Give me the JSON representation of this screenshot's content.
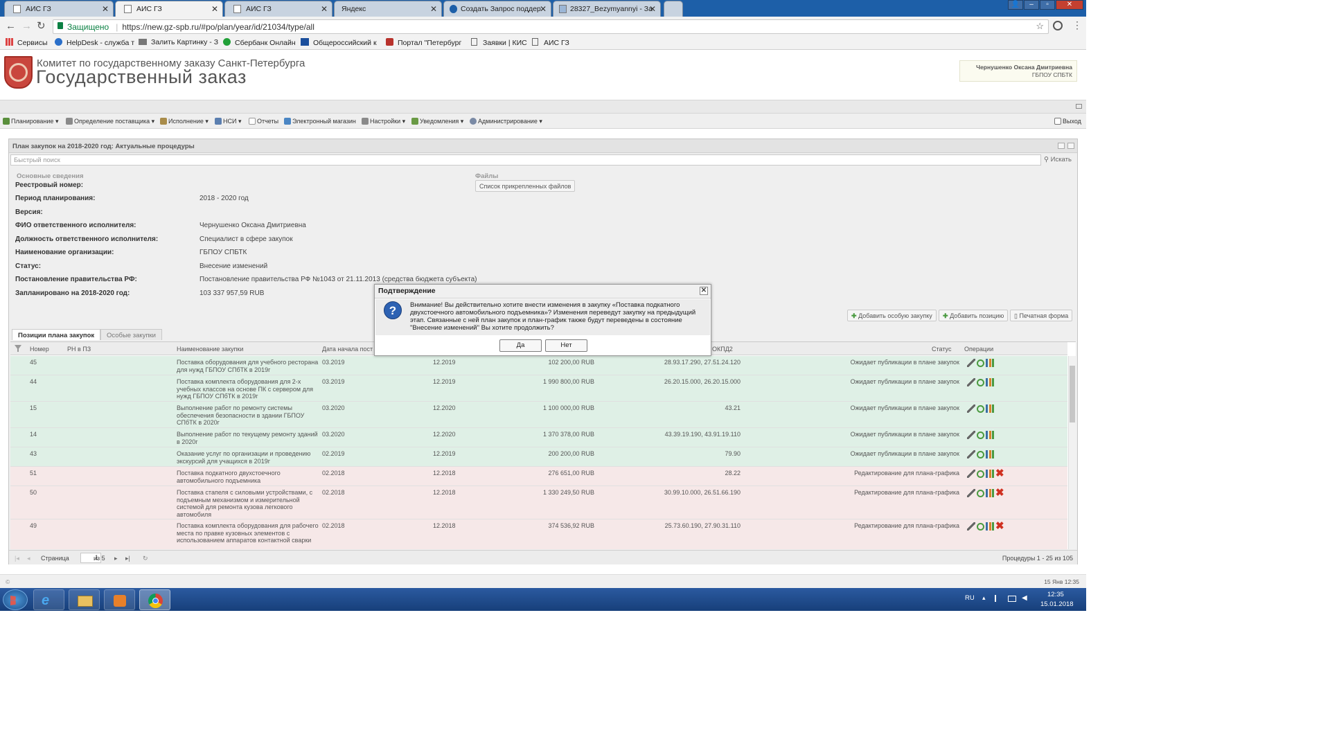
{
  "browser": {
    "tabs": [
      {
        "title": "АИС ГЗ"
      },
      {
        "title": "АИС ГЗ"
      },
      {
        "title": "АИС ГЗ"
      },
      {
        "title": "Яндекс"
      },
      {
        "title": "Создать Запрос поддер"
      },
      {
        "title": "28327_Bezymyannyi - За"
      }
    ],
    "security_label": "Защищено",
    "url": "https://new.gz-spb.ru/#po/plan/year/id/21034/type/all",
    "bookmarks": [
      {
        "label": "Сервисы"
      },
      {
        "label": "HelpDesk - служба т"
      },
      {
        "label": "Залить Картинку - З"
      },
      {
        "label": "Сбербанк Онлайн"
      },
      {
        "label": "Общероссийский к"
      },
      {
        "label": "Портал \"Петербург"
      },
      {
        "label": "Заявки | КИС"
      },
      {
        "label": "АИС ГЗ"
      }
    ]
  },
  "header": {
    "org_line": "Комитет по государственному заказу Санкт-Петербурга",
    "app_title": "Государственный заказ",
    "user_name": "Чернушенко Оксана Дмитриевна",
    "user_org": "ГБПОУ СПБТК"
  },
  "menu": {
    "items": [
      {
        "label": "Планирование"
      },
      {
        "label": "Определение поставщика"
      },
      {
        "label": "Исполнение"
      },
      {
        "label": "НСИ"
      },
      {
        "label": "Отчеты"
      },
      {
        "label": "Электронный магазин"
      },
      {
        "label": "Настройки"
      },
      {
        "label": "Уведомления"
      },
      {
        "label": "Администрирование"
      }
    ],
    "logout": "Выход"
  },
  "panel": {
    "title": "План закупок на 2018-2020 год: Актуальные процедуры",
    "search_placeholder": "Быстрый поиск",
    "search_button": "Искать",
    "section_main": "Основные сведения",
    "section_files": "Файлы",
    "files_button": "Список прикрепленных файлов",
    "fields": [
      {
        "label": "Реестровый номер:",
        "value": ""
      },
      {
        "label": "Период планирования:",
        "value": "2018 - 2020 год"
      },
      {
        "label": "Версия:",
        "value": ""
      },
      {
        "label": "ФИО ответственного исполнителя:",
        "value": "Чернушенко Оксана Дмитриевна"
      },
      {
        "label": "Должность ответственного исполнителя:",
        "value": "Специалист в сфере закупок"
      },
      {
        "label": "Наименование организации:",
        "value": "ГБПОУ СПБТК"
      },
      {
        "label": "Статус:",
        "value": "Внесение изменений"
      },
      {
        "label": "Постановление правительства РФ:",
        "value": "Постановление правительства РФ №1043 от 21.11.2013 (средства бюджета субъекта)"
      },
      {
        "label": "Запланировано на 2018-2020 год:",
        "value": "103 337 957,59 RUB"
      }
    ],
    "actions": {
      "add_special": "Добавить особую закупку",
      "add_position": "Добавить позицию",
      "print_form": "Печатная форма"
    },
    "tabs": [
      {
        "label": "Позиции плана закупок"
      },
      {
        "label": "Особые закупки"
      }
    ]
  },
  "grid": {
    "columns": {
      "number": "Номер",
      "rn": "РН в ПЗ",
      "name": "Наименование закупки",
      "start": "Дата начала пост",
      "okpd": "ОКПД2",
      "status": "Статус",
      "ops": "Операции"
    },
    "rows": [
      {
        "number": "45",
        "name": "Поставка оборудования для учебного ресторана для нужд ГБПОУ СПбТК в 2019г",
        "start": "03.2019",
        "end": "12.2019",
        "sum": "102 200,00 RUB",
        "okpd": "28.93.17.290, 27.51.24.120",
        "status": "Ожидает публикации в плане закупок"
      },
      {
        "number": "44",
        "name": "Поставка комплекта оборудования для 2-х учебных классов на основе ПК с сервером для нужд ГБПОУ СПбТК в 2019г",
        "start": "03.2019",
        "end": "12.2019",
        "sum": "1 990 800,00 RUB",
        "okpd": "26.20.15.000, 26.20.15.000",
        "status": "Ожидает публикации в плане закупок"
      },
      {
        "number": "15",
        "name": "Выполнение работ по ремонту системы обеспечения безопасности в здании ГБПОУ СПбТК в 2020г",
        "start": "03.2020",
        "end": "12.2020",
        "sum": "1 100 000,00 RUB",
        "okpd": "43.21",
        "status": "Ожидает публикации в плане закупок"
      },
      {
        "number": "14",
        "name": "Выполнение работ по текущему ремонту зданий в 2020г",
        "start": "03.2020",
        "end": "12.2020",
        "sum": "1 370 378,00 RUB",
        "okpd": "43.39.19.190, 43.91.19.110",
        "status": "Ожидает публикации в плане закупок"
      },
      {
        "number": "43",
        "name": "Оказание услуг по организации и проведению экскурсий для учащихся в 2019г",
        "start": "02.2019",
        "end": "12.2019",
        "sum": "200 200,00 RUB",
        "okpd": "79.90",
        "status": "Ожидает публикации в плане закупок"
      },
      {
        "number": "51",
        "name": "Поставка подкатного двухстоечного автомобильного подъемника",
        "start": "02.2018",
        "end": "12.2018",
        "sum": "276 651,00 RUB",
        "okpd": "28.22",
        "status": "Редактирование для плана-графика"
      },
      {
        "number": "50",
        "name": "Поставка стапеля с силовыми устройствами, с подъемным механизмом и измерительной системой для ремонта кузова легкового автомобиля",
        "start": "02.2018",
        "end": "12.2018",
        "sum": "1 330 249,50 RUB",
        "okpd": "30.99.10.000, 26.51.66.190",
        "status": "Редактирование для плана-графика"
      },
      {
        "number": "49",
        "name": "Поставка комплекта оборудования для рабочего места по правке кузовных элементов с использованием аппаратов контактной сварки",
        "start": "02.2018",
        "end": "12.2018",
        "sum": "374 536,92 RUB",
        "okpd": "25.73.60.190, 27.90.31.110",
        "status": "Редактирование для плана-графика"
      }
    ]
  },
  "pager": {
    "page_label": "Страница",
    "page_value": "1",
    "of_label": "из 5",
    "summary": "Процедуры 1 - 25 из 105"
  },
  "dialog": {
    "title": "Подтверждение",
    "message": "Внимание! Вы действительно хотите внести изменения в закупку «Поставка подкатного двухстоечного автомобильного подъемника»? Изменения переведут закупку на предыдущий этап. Связанные с ней план закупок и план-график также будут переведены в состояние \"Внесение изменений\" Вы хотите продолжить?",
    "yes": "Да",
    "no": "Нет"
  },
  "statusbar": {
    "datetime": "15 Янв 12:35"
  },
  "taskbar": {
    "lang": "RU",
    "time": "12:35",
    "date": "15.01.2018"
  }
}
